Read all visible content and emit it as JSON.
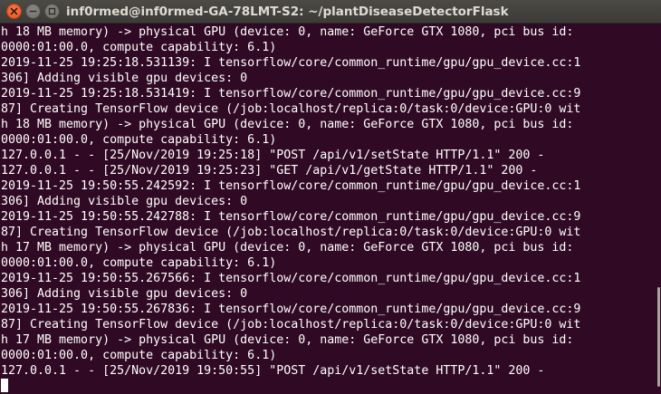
{
  "window": {
    "title": "inf0rmed@inf0rmed-GA-78LMT-S2: ~/plantDiseaseDetectorFlask",
    "buttons": {
      "close": "close-icon",
      "minimize": "minimize-icon",
      "maximize": "maximize-icon"
    },
    "colors": {
      "background": "#300a24",
      "titlebar": "#3c3b37",
      "text": "#ffffff",
      "close_button": "#e9541f"
    }
  },
  "terminal": {
    "lines": [
      "h 18 MB memory) -> physical GPU (device: 0, name: GeForce GTX 1080, pci bus id:",
      "0000:01:00.0, compute capability: 6.1)",
      "2019-11-25 19:25:18.531139: I tensorflow/core/common_runtime/gpu/gpu_device.cc:1",
      "306] Adding visible gpu devices: 0",
      "2019-11-25 19:25:18.531419: I tensorflow/core/common_runtime/gpu/gpu_device.cc:9",
      "87] Creating TensorFlow device (/job:localhost/replica:0/task:0/device:GPU:0 wit",
      "h 18 MB memory) -> physical GPU (device: 0, name: GeForce GTX 1080, pci bus id:",
      "0000:01:00.0, compute capability: 6.1)",
      "127.0.0.1 - - [25/Nov/2019 19:25:18] \"POST /api/v1/setState HTTP/1.1\" 200 -",
      "127.0.0.1 - - [25/Nov/2019 19:25:23] \"GET /api/v1/getState HTTP/1.1\" 200 -",
      "2019-11-25 19:50:55.242592: I tensorflow/core/common_runtime/gpu/gpu_device.cc:1",
      "306] Adding visible gpu devices: 0",
      "2019-11-25 19:50:55.242788: I tensorflow/core/common_runtime/gpu/gpu_device.cc:9",
      "87] Creating TensorFlow device (/job:localhost/replica:0/task:0/device:GPU:0 wit",
      "h 17 MB memory) -> physical GPU (device: 0, name: GeForce GTX 1080, pci bus id:",
      "0000:01:00.0, compute capability: 6.1)",
      "2019-11-25 19:50:55.267566: I tensorflow/core/common_runtime/gpu/gpu_device.cc:1",
      "306] Adding visible gpu devices: 0",
      "2019-11-25 19:50:55.267836: I tensorflow/core/common_runtime/gpu/gpu_device.cc:9",
      "87] Creating TensorFlow device (/job:localhost/replica:0/task:0/device:GPU:0 wit",
      "h 17 MB memory) -> physical GPU (device: 0, name: GeForce GTX 1080, pci bus id:",
      "0000:01:00.0, compute capability: 6.1)",
      "127.0.0.1 - - [25/Nov/2019 19:50:55] \"POST /api/v1/setState HTTP/1.1\" 200 -",
      ""
    ]
  }
}
